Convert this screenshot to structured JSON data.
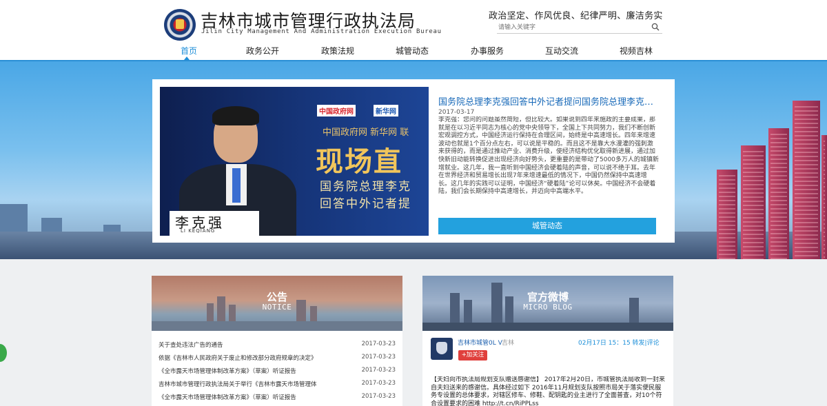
{
  "header": {
    "title": "吉林市城市管理行政执法局",
    "subtitle": "Jilin City Management And Administration Execution Bureau",
    "slogan": "政治坚定、作风优良、纪律严明、廉洁务实",
    "search_placeholder": "请输入关键字"
  },
  "nav": {
    "items": [
      "首页",
      "政务公开",
      "政策法规",
      "城管动态",
      "办事服务",
      "互动交流",
      "视频吉林"
    ],
    "active_index": 0
  },
  "feature": {
    "photo": {
      "logo1": "中国政府网",
      "logo2": "新华网",
      "line_top": "中国政府网 新华网 联",
      "big": "现场直",
      "line1": "国务院总理李克",
      "line2": "回答中外记者提",
      "nameplate_cn": "李克强",
      "nameplate_en": "LI KEQIANG"
    },
    "title": "国务院总理李克强回答中外记者提问国务院总理李克强回答中外记者提问",
    "date": "2017-03-17",
    "text": "李克强：您问的问题虽然简短，但比较大。如果说到四年来施政的主要成果，那就是在以习近平同志为核心的党中央领导下，全国上下共同努力，我们不断创新宏观调控方式，中国经济运行保持在合理区间，始终是中高速增长。四年来增速波动也就是1个百分点左右，可以说是平稳的。而且这不是靠大水漫灌的强刺激来获得的，而是通过推动产业、消费升级，使经济结构优化取得新进展，通过加快新旧动能转换促进出现经济向好势头，更重要的是带动了5000多万人的城镇新增就业。这几年，我一直听到中国经济会硬着陆的声音，可以说不绝于耳。去年在世界经济和贸易增长出现7年来增速最低的情况下，中国仍然保持中高速增长。这几年的实践可以证明，中国经济“硬着陆”论可以休矣。中国经济不会硬着陆，我们会长期保持中高速增长，并迈向中高端水平。",
    "button": "城管动态"
  },
  "notice": {
    "title": "公告",
    "subtitle": "NOTICE",
    "rows": [
      {
        "title": "关于查处违法广告的通告",
        "date": "2017-03-23"
      },
      {
        "title": "依据《吉林市人民政府关于废止和修改部分政府规章的决定》",
        "date": "2017-03-23"
      },
      {
        "title": "《全市露天市场管理体制改革方案》（草案）听证报告",
        "date": "2017-03-23"
      },
      {
        "title": "吉林市城市管理行政执法局关于举行《吉林市露天市场管理体",
        "date": "2017-03-23"
      },
      {
        "title": "《全市露天市场管理体制改革方案》（草案）听证报告",
        "date": "2017-03-23"
      }
    ]
  },
  "weibo": {
    "title": "官方微博",
    "subtitle": "MICRO BLOG",
    "user": "吉林市城管0L V",
    "location": "吉林",
    "meta": "02月17日 15：15 转发|评论",
    "follow": "+加关注",
    "text": "【夫妇向市执法局规划支队赠送感谢信】 2017年2月20日，市城管执法局收到一封来自夫妇送来的感谢信。具体经过如下 2016年11月规划支队按照市局关于落实便民服务专设置的总体要求，对辖区修车、修鞋、配钥匙的业主进行了全面普查，对10个符合设置要求的困难 http://t.cn/RiPPLss"
  },
  "colors": {
    "accent": "#1e8ed8",
    "button": "#23a1de",
    "follow": "#e0403d"
  }
}
